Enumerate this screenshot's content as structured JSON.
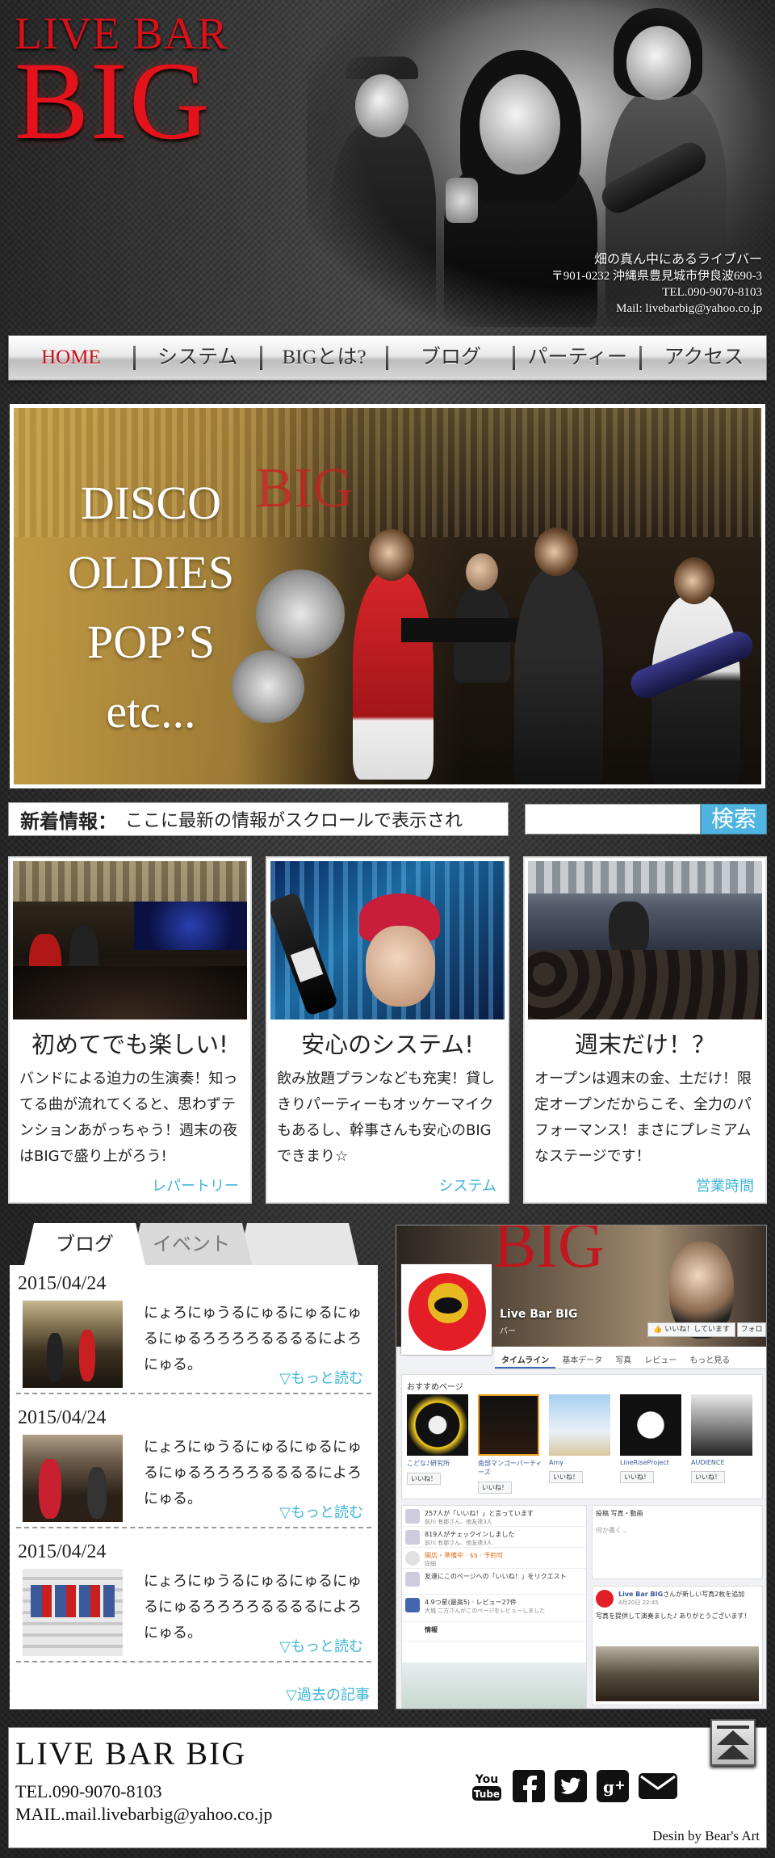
{
  "header": {
    "logo_line1": "LIVE BAR",
    "logo_line2": "BIG",
    "tagline": "畑の真ん中にあるライブバー",
    "address": "〒901-0232 沖縄県豊見城市伊良波690-3",
    "tel": "TEL.090-9070-8103",
    "mail": "Mail: livebarbig@yahoo.co.jp"
  },
  "nav": {
    "items": [
      {
        "label": "HOME",
        "active": true
      },
      {
        "label": "システム"
      },
      {
        "label": "BIGとは?"
      },
      {
        "label": "ブログ"
      },
      {
        "label": "パーティー"
      },
      {
        "label": "アクセス"
      }
    ]
  },
  "banner": {
    "line1": "DISCO",
    "line2": "OLDIES",
    "line3": "POP’S",
    "line4": "etc..."
  },
  "news": {
    "label": "新着情報：",
    "text": "ここに最新の情報がスクロールで表示され"
  },
  "search": {
    "placeholder": "",
    "button": "検索"
  },
  "cards": [
    {
      "title": "初めてでも楽しい!",
      "body": "バンドによる迫力の生演奏！知ってる曲が流れてくると、思わずテンションあがっちゃう！週末の夜はBIGで盛り上がろう!",
      "link": "レパートリー"
    },
    {
      "title": "安心のシステム!",
      "body": "飲み放題プランなども充実！貸しきりパーティーもオッケーマイクもあるし、幹事さんも安心のBIGできまり☆",
      "link": "システム"
    },
    {
      "title": "週末だけ！？",
      "body": "オープンは週末の金、土だけ！限定オープンだからこそ、全力のパフォーマンス！まさにプレミアムなステージです！",
      "link": "営業時間"
    }
  ],
  "blog": {
    "tabs": [
      "ブログ",
      "イベント"
    ],
    "posts": [
      {
        "date": "2015/04/24",
        "text": "にょろにゅうるにゅるにゅるにゅるにゅるろろろろるるるるによろにゅる。",
        "more": "▽もっと読む"
      },
      {
        "date": "2015/04/24",
        "text": "にょろにゅうるにゅるにゅるにゅるにゅるろろろろるるるるによろにゅる。",
        "more": "▽もっと読む"
      },
      {
        "date": "2015/04/24",
        "text": "にょろにゅうるにゅるにゅるにゅるにゅるろろろろるるるるによろにゅる。",
        "more": "▽もっと読む"
      }
    ],
    "past": "▽過去の記事"
  },
  "facebook": {
    "page_name": "Live Bar BIG",
    "category": "バー",
    "like_button": "いいね！しています",
    "follow_button": "フォロー",
    "tabs": [
      "タイムライン",
      "基本データ",
      "写真",
      "レビュー",
      "もっと見る"
    ],
    "recommend_title": "おすすめページ",
    "recommend": [
      {
        "name": "こどな♪研究所",
        "btn": "いいね！"
      },
      {
        "name": "南部マンゴーパーティーズ",
        "btn": "いいね！"
      },
      {
        "name": "Amy",
        "btn": "いいね！"
      },
      {
        "name": "LineRiseProject",
        "btn": "いいね！"
      },
      {
        "name": "AUDIENCE",
        "btn": "いいね！"
      }
    ],
    "activity": [
      {
        "main": "257人が「いいね！」と言っています",
        "sub": "前川 有那さん、他友達3人"
      },
      {
        "main": "819人がチェックインしました",
        "sub": "前川 有那さん、他友達3人"
      },
      {
        "main": "開店・準備中 · $$ · 予約可",
        "sub": "詳細"
      },
      {
        "main": "友達にこのページへの「いいね！」をリクエスト",
        "sub": ""
      },
      {
        "main": "4.9つ星(最高5) · レビュー27件",
        "sub": "大城 二方さんがこのページをレビューしました"
      },
      {
        "main": "情報",
        "sub": ""
      }
    ],
    "post_box_tabs": "投稿  写真・動画",
    "post_box_placeholder": "何か書く...",
    "post_author": "Live Bar BIG",
    "post_action": "さんが新しい写真2枚を追加",
    "post_time": "4月20日 22:45",
    "post_text": "写真を提供して演奏ました♪ ありがとうございます！"
  },
  "footer": {
    "title": "LIVE BAR BIG",
    "tel": "TEL.090-9070-8103",
    "mail": "MAIL.mail.livebarbig@yahoo.co.jp",
    "credit": "Desin by Bear's Art",
    "social": [
      "youtube-icon",
      "facebook-icon",
      "twitter-icon",
      "google-plus-icon",
      "mail-icon"
    ]
  },
  "colors": {
    "logo_red": "#e4121b",
    "link_blue": "#3fb5d6",
    "search_blue": "#4fb5e0",
    "facebook_blue": "#4267b2"
  }
}
